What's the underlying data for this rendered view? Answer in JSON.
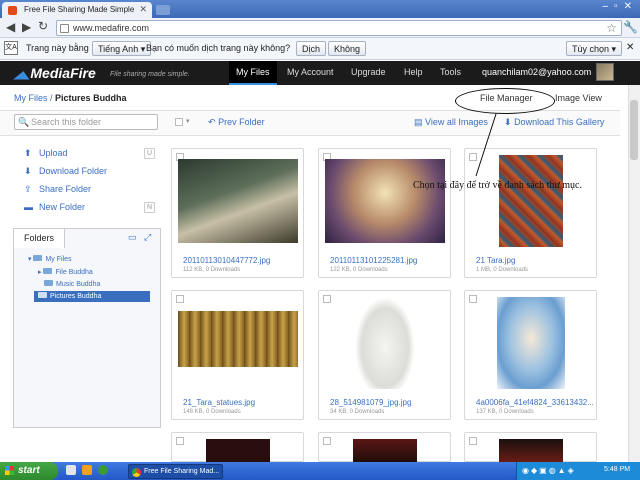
{
  "browser": {
    "tab_title": "Free File Sharing Made Simple",
    "address": "www.medafire.com",
    "translate_prompt": "Trang này bằng",
    "language_select": "Tiếng Anh",
    "translate_question": "Bạn có muốn dịch trang này không?",
    "translate_button": "Dịch",
    "no_button": "Không",
    "options_button": "Tùy chọn"
  },
  "header": {
    "logo": "MediaFire",
    "tagline": "File sharing made simple.",
    "nav": [
      "My Files",
      "My Account",
      "Upgrade",
      "Help",
      "Tools"
    ],
    "email": "quanchilam02@yahoo.com"
  },
  "breadcrumb": {
    "root": "My Files",
    "separator": "/",
    "current": "Pictures Buddha"
  },
  "views": {
    "file_manager": "File Manager",
    "image_view": "Image View"
  },
  "actions": {
    "search_placeholder": "Search this folder",
    "prev_folder": "Prev Folder",
    "view_all_images": "View all Images",
    "download_gallery": "Download This Gallery"
  },
  "sidebar": {
    "items": [
      {
        "label": "Upload",
        "badge": "U"
      },
      {
        "label": "Download Folder",
        "badge": ""
      },
      {
        "label": "Share Folder",
        "badge": ""
      },
      {
        "label": "New Folder",
        "badge": "N"
      }
    ],
    "folders_tab": "Folders",
    "tree": [
      "My Files",
      "File Buddha",
      "Music Buddha",
      "Pictures Buddha"
    ]
  },
  "files": [
    {
      "name": "20110113010447772.jpg",
      "meta": "112 KB, 0 Downloads"
    },
    {
      "name": "20110113101225281.jpg",
      "meta": "122 KB, 0 Downloads"
    },
    {
      "name": "21 Tara.jpg",
      "meta": "1 MB, 0 Downloads"
    },
    {
      "name": "21_Tara_statues.jpg",
      "meta": "148 KB, 0 Downloads"
    },
    {
      "name": "28_514981079_jpg.jpg",
      "meta": "34 KB, 0 Downloads"
    },
    {
      "name": "4a0006fa_41ef4824_33613432...",
      "meta": "137 KB, 0 Downloads"
    }
  ],
  "annotation": "Chọn tại đây để trở về danh sách thư mục.",
  "taskbar": {
    "start": "start",
    "task": "Free File Sharing Mad...",
    "clock": "5:48 PM"
  }
}
